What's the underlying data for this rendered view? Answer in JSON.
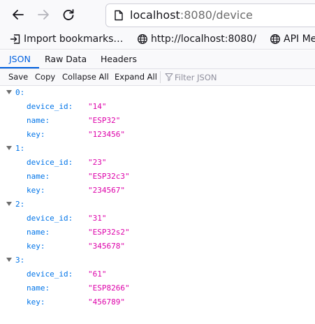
{
  "browser": {
    "url_host": "localhost",
    "url_rest": ":8080/device",
    "colors": {
      "accent": "#0060df",
      "key": "#0074e8",
      "string": "#dd00a9"
    }
  },
  "bookmarks": [
    {
      "label": "Import bookmarks…",
      "icon": "import-icon"
    },
    {
      "label": "http://localhost:8080/",
      "icon": "globe-icon"
    },
    {
      "label": "API Me",
      "icon": "globe-icon"
    }
  ],
  "viewer": {
    "tabs": [
      {
        "label": "JSON",
        "selected": true
      },
      {
        "label": "Raw Data",
        "selected": false
      },
      {
        "label": "Headers",
        "selected": false
      }
    ],
    "toolbar": {
      "save": "Save",
      "copy": "Copy",
      "collapse_all": "Collapse All",
      "expand_all": "Expand All",
      "filter_placeholder": "Filter JSON"
    }
  },
  "json": [
    {
      "index": "0:",
      "fields": [
        {
          "key": "device_id:",
          "value": "\"14\""
        },
        {
          "key": "name:",
          "value": "\"ESP32\""
        },
        {
          "key": "key:",
          "value": "\"123456\""
        }
      ]
    },
    {
      "index": "1:",
      "fields": [
        {
          "key": "device_id:",
          "value": "\"23\""
        },
        {
          "key": "name:",
          "value": "\"ESP32c3\""
        },
        {
          "key": "key:",
          "value": "\"234567\""
        }
      ]
    },
    {
      "index": "2:",
      "fields": [
        {
          "key": "device_id:",
          "value": "\"31\""
        },
        {
          "key": "name:",
          "value": "\"ESP32s2\""
        },
        {
          "key": "key:",
          "value": "\"345678\""
        }
      ]
    },
    {
      "index": "3:",
      "fields": [
        {
          "key": "device_id:",
          "value": "\"61\""
        },
        {
          "key": "name:",
          "value": "\"ESP8266\""
        },
        {
          "key": "key:",
          "value": "\"456789\""
        }
      ]
    }
  ]
}
